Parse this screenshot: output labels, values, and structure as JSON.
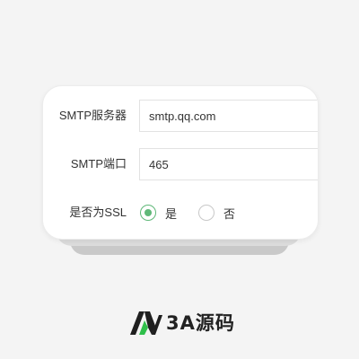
{
  "form": {
    "smtp_server_label": "SMTP服务器",
    "smtp_server_value": "smtp.qq.com",
    "smtp_port_label": "SMTP端口",
    "smtp_port_value": "465",
    "ssl_label": "是否为SSL",
    "ssl_options": [
      {
        "label": "是",
        "selected": true
      },
      {
        "label": "否",
        "selected": false
      }
    ]
  },
  "branding": {
    "logo_text": "3A源码"
  },
  "colors": {
    "accent": "#5fb878",
    "logo_green": "#2fbf4a",
    "logo_dark": "#1f1f1f"
  }
}
